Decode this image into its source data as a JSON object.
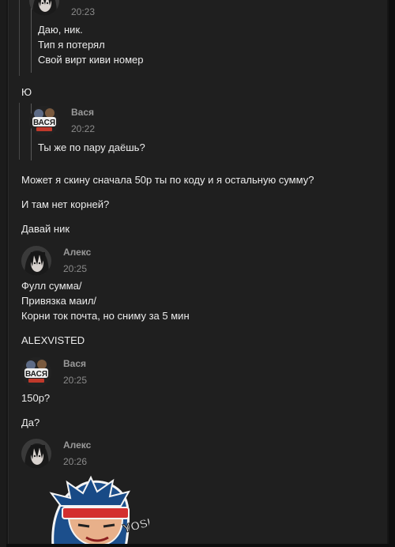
{
  "colors": {
    "background": "#161616",
    "panel": "#1f1f1f",
    "text": "#ececec",
    "author": "#9a9a9a",
    "time": "#8a8a8a",
    "quote_line": "#5a5a5a"
  },
  "messages": {
    "q1": {
      "time": "20:23",
      "lines": [
        "Даю, ник.",
        "Тип я потерял",
        "Свой вирт киви номер"
      ]
    },
    "m_yu": "Ю",
    "q2": {
      "author": "Вася",
      "time": "20:22",
      "avatar_icon": "vasya-avatar-icon",
      "text": "Ты же по пару даёшь?"
    },
    "m_skinu": "Может я скину сначала 50р ты по коду и я остальную сумму?",
    "m_korney": "И там нет корней?",
    "m_nik": "Давай ник",
    "g1": {
      "author": "Алекс",
      "time": "20:25",
      "avatar_icon": "aleks-avatar-icon",
      "lines": [
        "Фулл сумма/",
        "Привязка маил/",
        "Корни ток почта, но сниму за 5 мин"
      ]
    },
    "m_alex": "ALEXVISTED",
    "g2": {
      "author": "Вася",
      "time": "20:25",
      "avatar_icon": "vasya-avatar-icon",
      "text": "150р?"
    },
    "m_da": "Да?",
    "g3": {
      "author": "Алекс",
      "time": "20:26",
      "avatar_icon": "aleks-avatar-icon",
      "sticker_icon": "yosh-sticker-icon",
      "sticker_text": "YOSH!"
    }
  }
}
